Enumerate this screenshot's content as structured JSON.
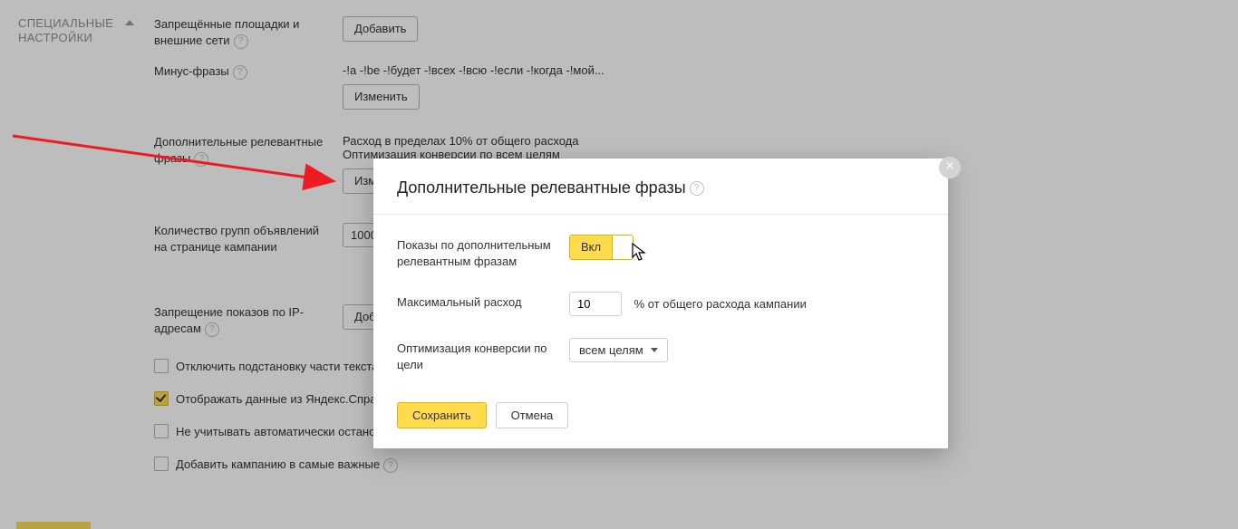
{
  "section_title": "СПЕЦИАЛЬНЫЕ\nНАСТРОЙКИ",
  "rows": {
    "banned_sites": {
      "label": "Запрещённые площадки и внешние сети",
      "button": "Добавить"
    },
    "negative": {
      "label": "Минус-фразы",
      "summary": "-!а -!be -!будет -!всех -!всю -!если -!когда -!мой...",
      "button": "Изменить"
    },
    "relevant": {
      "label": "Дополнительные релевантные фразы",
      "summary1": "Расход в пределах 10% от общего расхода",
      "summary2": "Оптимизация конверсии по всем целям",
      "button": "Изменить"
    },
    "groups": {
      "label": "Количество групп объявлений на странице кампании",
      "value": "1000"
    },
    "ipban": {
      "label": "Запрещение показов по IP-адресам",
      "button": "Добавить"
    }
  },
  "checkboxes": {
    "c1": {
      "checked": false,
      "label": "Отключить подстановку части текста в заголовок"
    },
    "c2": {
      "checked": true,
      "label": "Отображать данные из Яндекс.Справочника при показе объявлений на Яндекс.Картах"
    },
    "c3": {
      "checked": false,
      "label": "Не учитывать автоматически остановленные объявления конкурентов при выставлении ставок"
    },
    "c4": {
      "checked": false,
      "label": "Добавить кампанию в самые важные"
    }
  },
  "modal": {
    "title": "Дополнительные релевантные фразы",
    "rows": {
      "toggle_label": "Показы по дополнительным релевантным фразам",
      "toggle_on": "Вкл",
      "spend_label": "Максимальный расход",
      "spend_value": "10",
      "spend_hint": "% от общего расхода кампании",
      "goal_label": "Оптимизация конверсии по цели",
      "goal_value": "всем целям"
    },
    "save": "Сохранить",
    "cancel": "Отмена"
  }
}
